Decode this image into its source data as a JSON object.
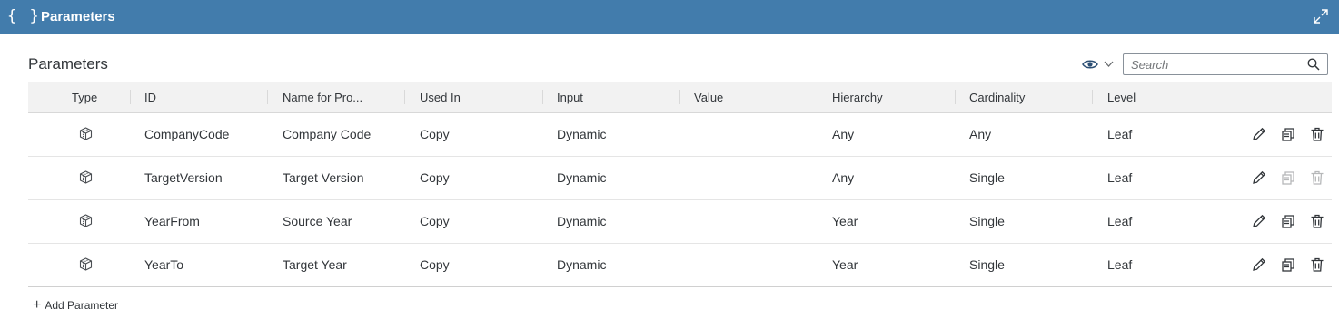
{
  "header": {
    "title": "Parameters",
    "braces": "{ }",
    "expand_icon": "expand-icon"
  },
  "section": {
    "title": "Parameters"
  },
  "toolbar": {
    "eye_icon": "eye-icon",
    "caret_icon": "chevron-down-icon"
  },
  "search": {
    "placeholder": "Search",
    "value": ""
  },
  "columns": [
    "Type",
    "ID",
    "Name for Pro...",
    "Used In",
    "Input",
    "Value",
    "Hierarchy",
    "Cardinality",
    "Level"
  ],
  "rows": [
    {
      "id": "CompanyCode",
      "name": "Company Code",
      "used_in": "Copy",
      "input": "Dynamic",
      "value": "",
      "hierarchy": "Any",
      "cardinality": "Any",
      "level": "Leaf",
      "copy_enabled": true,
      "delete_enabled": true
    },
    {
      "id": "TargetVersion",
      "name": "Target Version",
      "used_in": "Copy",
      "input": "Dynamic",
      "value": "",
      "hierarchy": "Any",
      "cardinality": "Single",
      "level": "Leaf",
      "copy_enabled": false,
      "delete_enabled": false
    },
    {
      "id": "YearFrom",
      "name": "Source Year",
      "used_in": "Copy",
      "input": "Dynamic",
      "value": "",
      "hierarchy": "Year",
      "cardinality": "Single",
      "level": "Leaf",
      "copy_enabled": true,
      "delete_enabled": true
    },
    {
      "id": "YearTo",
      "name": "Target Year",
      "used_in": "Copy",
      "input": "Dynamic",
      "value": "",
      "hierarchy": "Year",
      "cardinality": "Single",
      "level": "Leaf",
      "copy_enabled": true,
      "delete_enabled": true
    }
  ],
  "footer": {
    "add_label": "Add Parameter",
    "add_icon": "plus-icon"
  },
  "colors": {
    "header_bg": "#427cac",
    "icon": "#32363a"
  }
}
